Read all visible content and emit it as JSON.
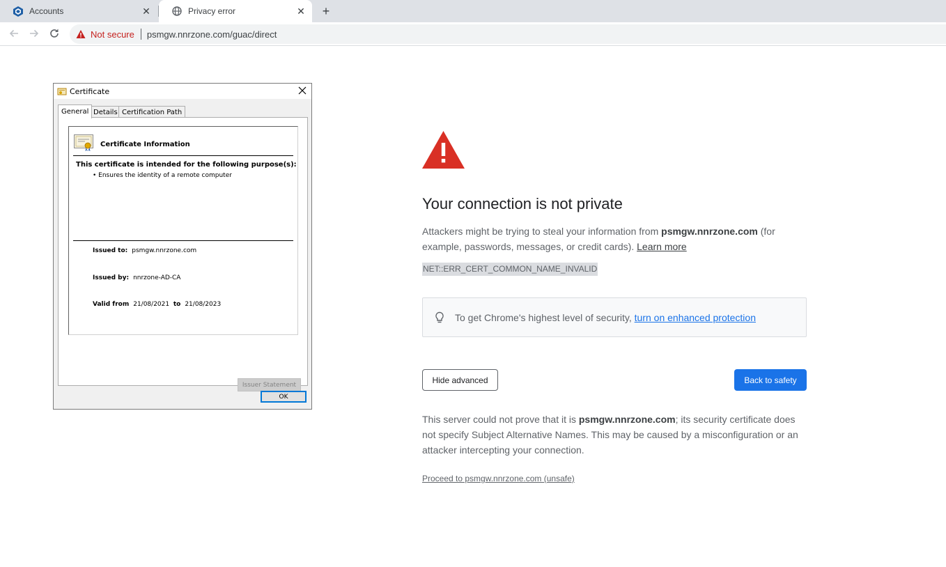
{
  "browser": {
    "tabs": [
      {
        "title": "Accounts",
        "icon": "app-logo-icon",
        "active": false
      },
      {
        "title": "Privacy error",
        "icon": "globe-icon",
        "active": true
      }
    ],
    "new_tab_label": "+",
    "security_label": "Not secure",
    "url": "psmgw.nnrzone.com/guac/direct"
  },
  "interstitial": {
    "headline": "Your connection is not private",
    "intro_before": "Attackers might be trying to steal your information from ",
    "host": "psmgw.nnrzone.com",
    "intro_after": " (for example, passwords, messages, or credit cards). ",
    "learn_more": "Learn more",
    "error_code": "NET::ERR_CERT_COMMON_NAME_INVALID",
    "enhanced_text": "To get Chrome's highest level of security, ",
    "enhanced_link": "turn on enhanced protection",
    "hide_advanced": "Hide advanced",
    "back_to_safety": "Back to safety",
    "details_before": "This server could not prove that it is ",
    "details_after": "; its security certificate does not specify Subject Alternative Names. This may be caused by a misconfiguration or an attacker intercepting your connection.",
    "proceed_link": "Proceed to psmgw.nnrzone.com (unsafe)"
  },
  "certificate_dialog": {
    "title": "Certificate",
    "tabs": [
      "General",
      "Details",
      "Certification Path"
    ],
    "active_tab": "General",
    "info_title": "Certificate Information",
    "purpose_heading": "This certificate is intended for the following purpose(s):",
    "purpose_item": "• Ensures the identity of a remote computer",
    "issued_to_label": "Issued to:",
    "issued_to": "psmgw.nnrzone.com",
    "issued_by_label": "Issued by:",
    "issued_by": "nnrzone-AD-CA",
    "valid_from_label": "Valid from",
    "valid_from": "21/08/2021",
    "valid_to_label": "to",
    "valid_to": "21/08/2023",
    "issuer_statement": "Issuer Statement",
    "ok": "OK"
  },
  "colors": {
    "error_red": "#d93025",
    "link_blue": "#1a73e8",
    "not_secure_red": "#c5221f"
  }
}
